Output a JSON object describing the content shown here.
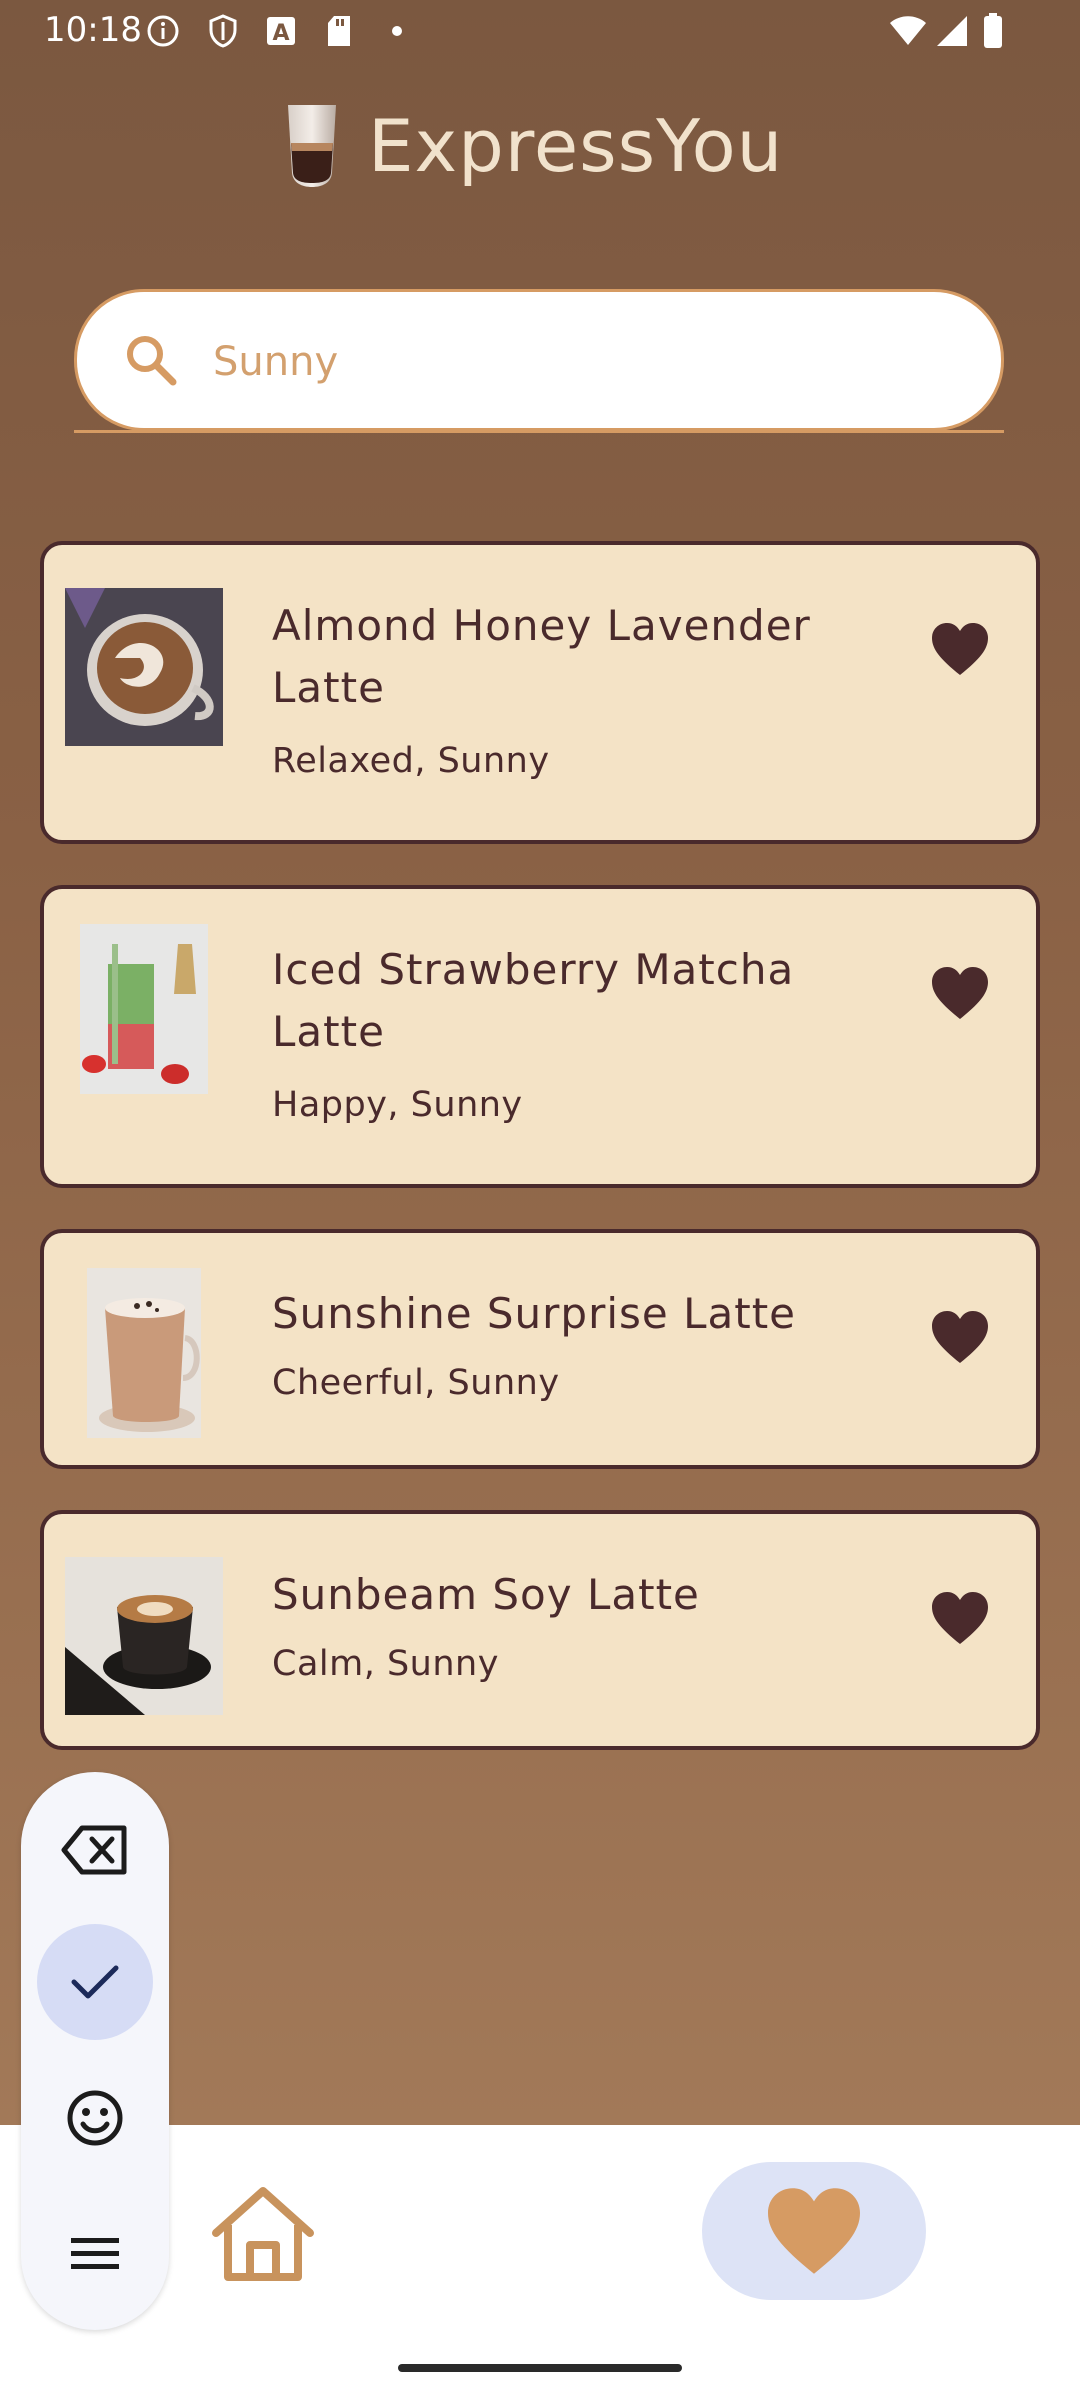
{
  "status_bar": {
    "time": "10:18",
    "icons_left": [
      "info-icon",
      "shield-icon",
      "a-icon",
      "sd-card-icon",
      "dot-icon"
    ],
    "icons_right": [
      "wifi-icon",
      "signal-icon",
      "battery-icon"
    ]
  },
  "app": {
    "title": "ExpressYou"
  },
  "search": {
    "value": "Sunny",
    "placeholder": ""
  },
  "results": [
    {
      "title": "Almond Honey Lavender Latte",
      "tags": "Relaxed, Sunny",
      "favorited": true
    },
    {
      "title": "Iced Strawberry Matcha Latte",
      "tags": "Happy, Sunny",
      "favorited": true
    },
    {
      "title": "Sunshine Surprise Latte",
      "tags": "Cheerful, Sunny",
      "favorited": true
    },
    {
      "title": "Sunbeam Soy Latte",
      "tags": "Calm, Sunny",
      "favorited": true
    }
  ],
  "bottom_nav": {
    "items": [
      {
        "name": "home",
        "selected": false
      },
      {
        "name": "favorites",
        "selected": true
      }
    ]
  },
  "keyboard_toolbar": {
    "buttons": [
      "backspace-icon",
      "check-icon",
      "emoji-icon",
      "menu-icon"
    ],
    "selected": "check-icon"
  },
  "colors": {
    "background_top": "#7b5840",
    "background_bottom": "#a27958",
    "card": "#f4e3c6",
    "card_border": "#4a2a2c",
    "accent": "#d69b63",
    "text_dark": "#4a2a2c"
  }
}
